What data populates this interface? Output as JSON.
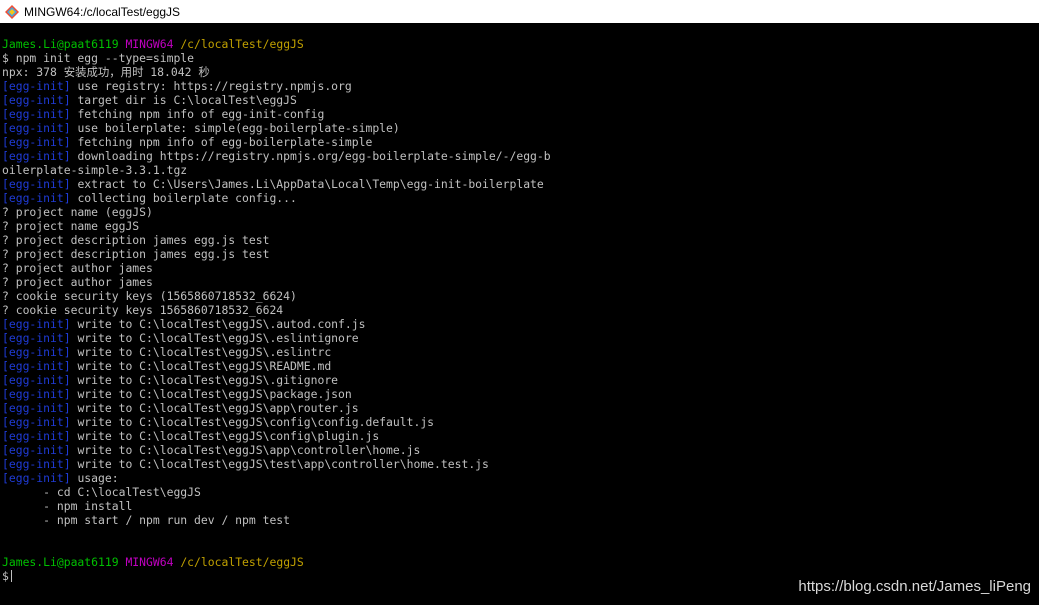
{
  "window": {
    "title": "MINGW64:/c/localTest/eggJS",
    "icon": "git-bash-diamond-icon"
  },
  "colors": {
    "background": "#000000",
    "text": "#c0c0c0",
    "user": "#00c000",
    "mingw": "#c000c0",
    "path": "#c0a000",
    "tag": "#1f3bd6"
  },
  "terminal": {
    "prompt1": {
      "user": "James.Li@paat6119",
      "env": "MINGW64",
      "path": "/c/localTest/eggJS"
    },
    "command": "$ npm init egg --type=simple",
    "npx_line": "npx: 378 安装成功，用时 18.042 秒",
    "tag": "[egg-init]",
    "log_a": [
      "use registry: https://registry.npmjs.org",
      "target dir is C:\\localTest\\eggJS",
      "fetching npm info of egg-init-config",
      "use boilerplate: simple(egg-boilerplate-simple)",
      "fetching npm info of egg-boilerplate-simple",
      "downloading https://registry.npmjs.org/egg-boilerplate-simple/-/egg-b"
    ],
    "wrap_line": "oilerplate-simple-3.3.1.tgz",
    "log_b": [
      "extract to C:\\Users\\James.Li\\AppData\\Local\\Temp\\egg-init-boilerplate",
      "collecting boilerplate config..."
    ],
    "questions": [
      "? project name (eggJS)",
      "? project name eggJS",
      "? project description james egg.js test",
      "? project description james egg.js test",
      "? project author james",
      "? project author james",
      "? cookie security keys (1565860718532_6624)",
      "? cookie security keys 1565860718532_6624"
    ],
    "log_c": [
      "write to C:\\localTest\\eggJS\\.autod.conf.js",
      "write to C:\\localTest\\eggJS\\.eslintignore",
      "write to C:\\localTest\\eggJS\\.eslintrc",
      "write to C:\\localTest\\eggJS\\README.md",
      "write to C:\\localTest\\eggJS\\.gitignore",
      "write to C:\\localTest\\eggJS\\package.json",
      "write to C:\\localTest\\eggJS\\app\\router.js",
      "write to C:\\localTest\\eggJS\\config\\config.default.js",
      "write to C:\\localTest\\eggJS\\config\\plugin.js",
      "write to C:\\localTest\\eggJS\\app\\controller\\home.js",
      "write to C:\\localTest\\eggJS\\test\\app\\controller\\home.test.js",
      "usage:"
    ],
    "usage_items": [
      "      - cd C:\\localTest\\eggJS",
      "      - npm install",
      "      - npm start / npm run dev / npm test"
    ],
    "prompt2": {
      "user": "James.Li@paat6119",
      "env": "MINGW64",
      "path": "/c/localTest/eggJS"
    },
    "prompt_symbol": "$"
  },
  "watermark": "https://blog.csdn.net/James_liPeng"
}
